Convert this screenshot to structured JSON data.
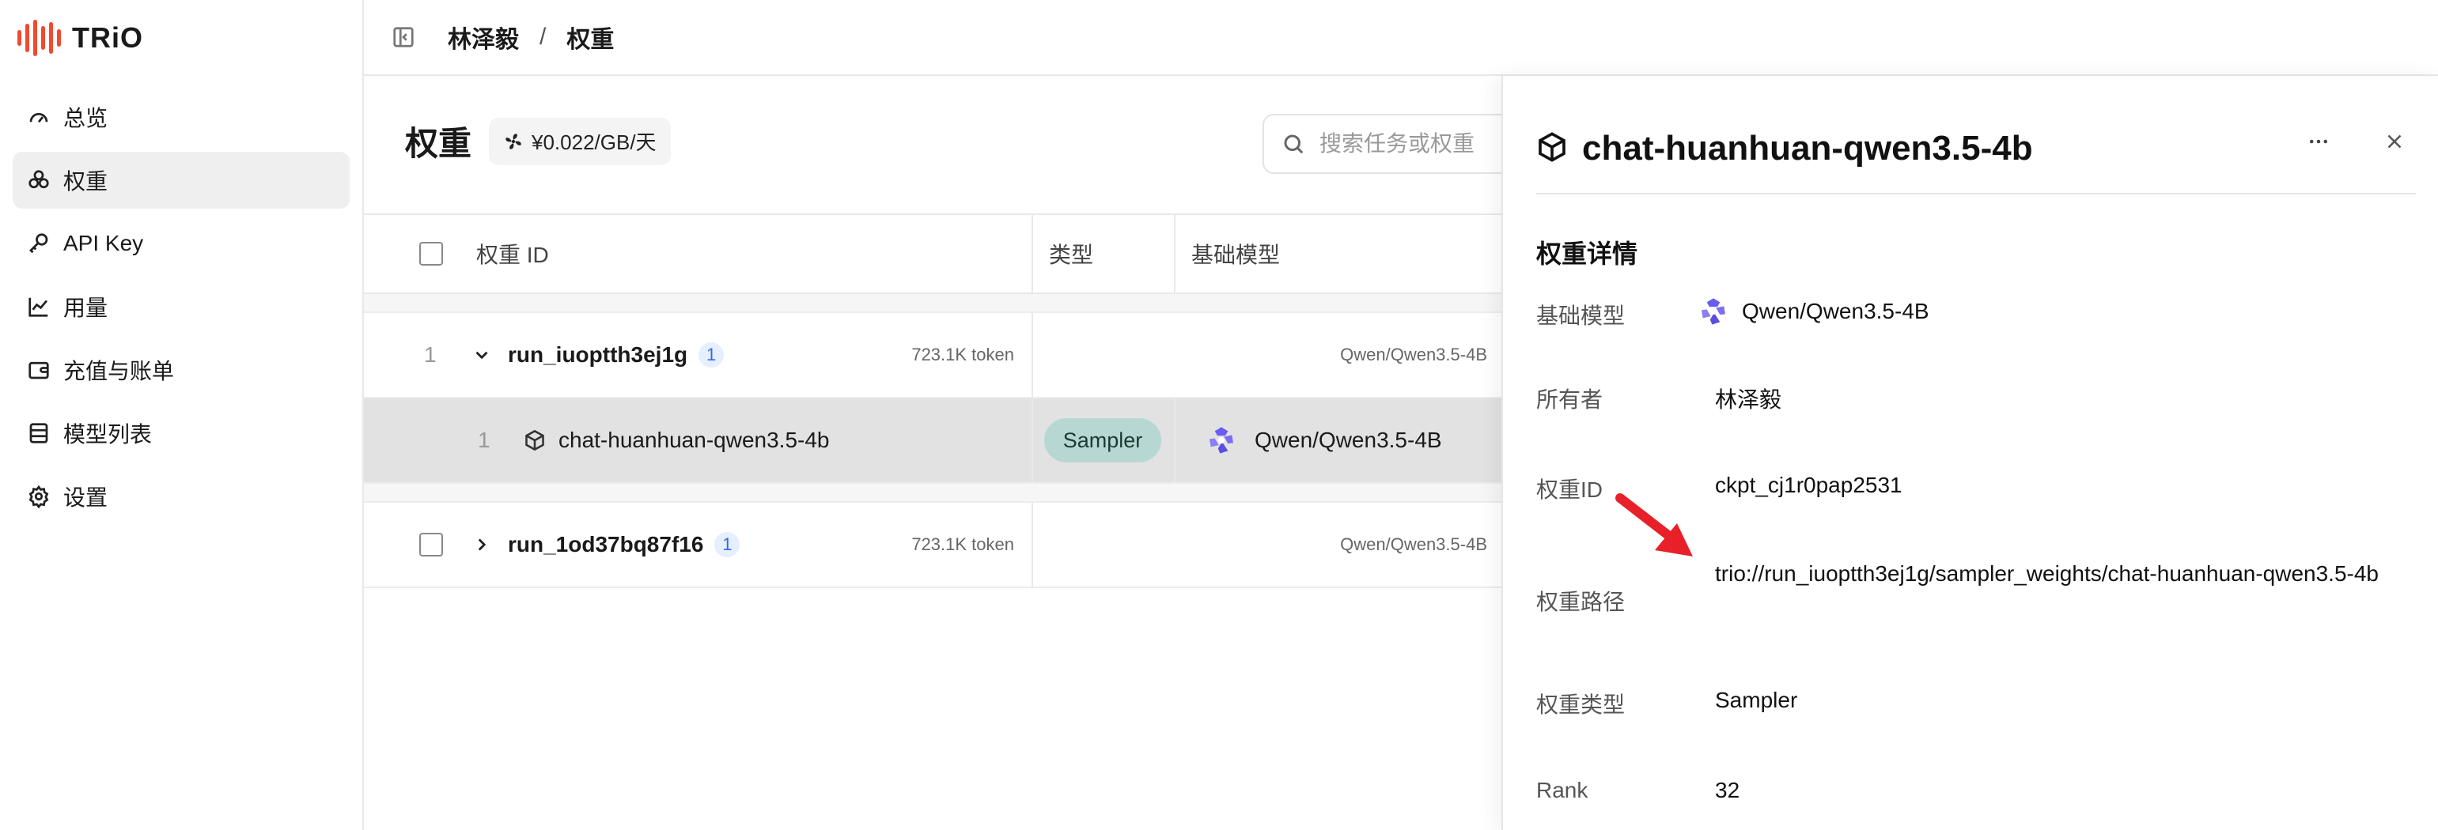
{
  "brand": {
    "name": "TRiO",
    "accent": "#ef4b2f"
  },
  "sidebar": {
    "items": [
      {
        "label": "总览",
        "icon": "gauge-icon",
        "active": false
      },
      {
        "label": "权重",
        "icon": "weights-icon",
        "active": true
      },
      {
        "label": "API Key",
        "icon": "key-icon",
        "active": false
      },
      {
        "label": "用量",
        "icon": "line-chart-icon",
        "active": false
      },
      {
        "label": "充值与账单",
        "icon": "wallet-icon",
        "active": false
      },
      {
        "label": "模型列表",
        "icon": "list-icon",
        "active": false
      },
      {
        "label": "设置",
        "icon": "gear-icon",
        "active": false
      }
    ]
  },
  "breadcrumb": {
    "user": "林泽毅",
    "separator": "/",
    "page": "权重"
  },
  "main": {
    "title": "权重",
    "price": "¥0.022/GB/天",
    "search_placeholder": "搜索任务或权重",
    "columns": {
      "id": "权重 ID",
      "type": "类型",
      "base_model": "基础模型"
    },
    "rows": [
      {
        "index": "1",
        "run_id": "run_iuoptth3ej1g",
        "count": "1",
        "tokens": "723.1K token",
        "base_model": "Qwen/Qwen3.5-4B",
        "expanded": true
      },
      {
        "index": "1",
        "weight_name": "chat-huanhuan-qwen3.5-4b",
        "type": "Sampler",
        "base_model": "Qwen/Qwen3.5-4B",
        "selected": true
      },
      {
        "run_id": "run_1od37bq87f16",
        "count": "1",
        "tokens": "723.1K token",
        "base_model": "Qwen/Qwen3.5-4B",
        "expanded": false
      }
    ]
  },
  "drawer": {
    "title": "chat-huanhuan-qwen3.5-4b",
    "section": "权重详情",
    "fields": {
      "base_model": {
        "label": "基础模型",
        "value": "Qwen/Qwen3.5-4B"
      },
      "owner": {
        "label": "所有者",
        "value": "林泽毅"
      },
      "weight_id": {
        "label": "权重ID",
        "value": "ckpt_cj1r0pap2531"
      },
      "path": {
        "label": "权重路径",
        "value": "trio://run_iuoptth3ej1g/sampler_weights/chat-huanhuan-qwen3.5-4b"
      },
      "weight_type": {
        "label": "权重类型",
        "value": "Sampler"
      },
      "rank": {
        "label": "Rank",
        "value": "32"
      }
    }
  },
  "colors": {
    "sampler_tag": "#b7d8d2",
    "selected_row": "#e2e2e2",
    "count_badge_bg": "#e6efff",
    "count_badge_fg": "#2f6de0",
    "annotation_arrow": "#e8202a"
  }
}
